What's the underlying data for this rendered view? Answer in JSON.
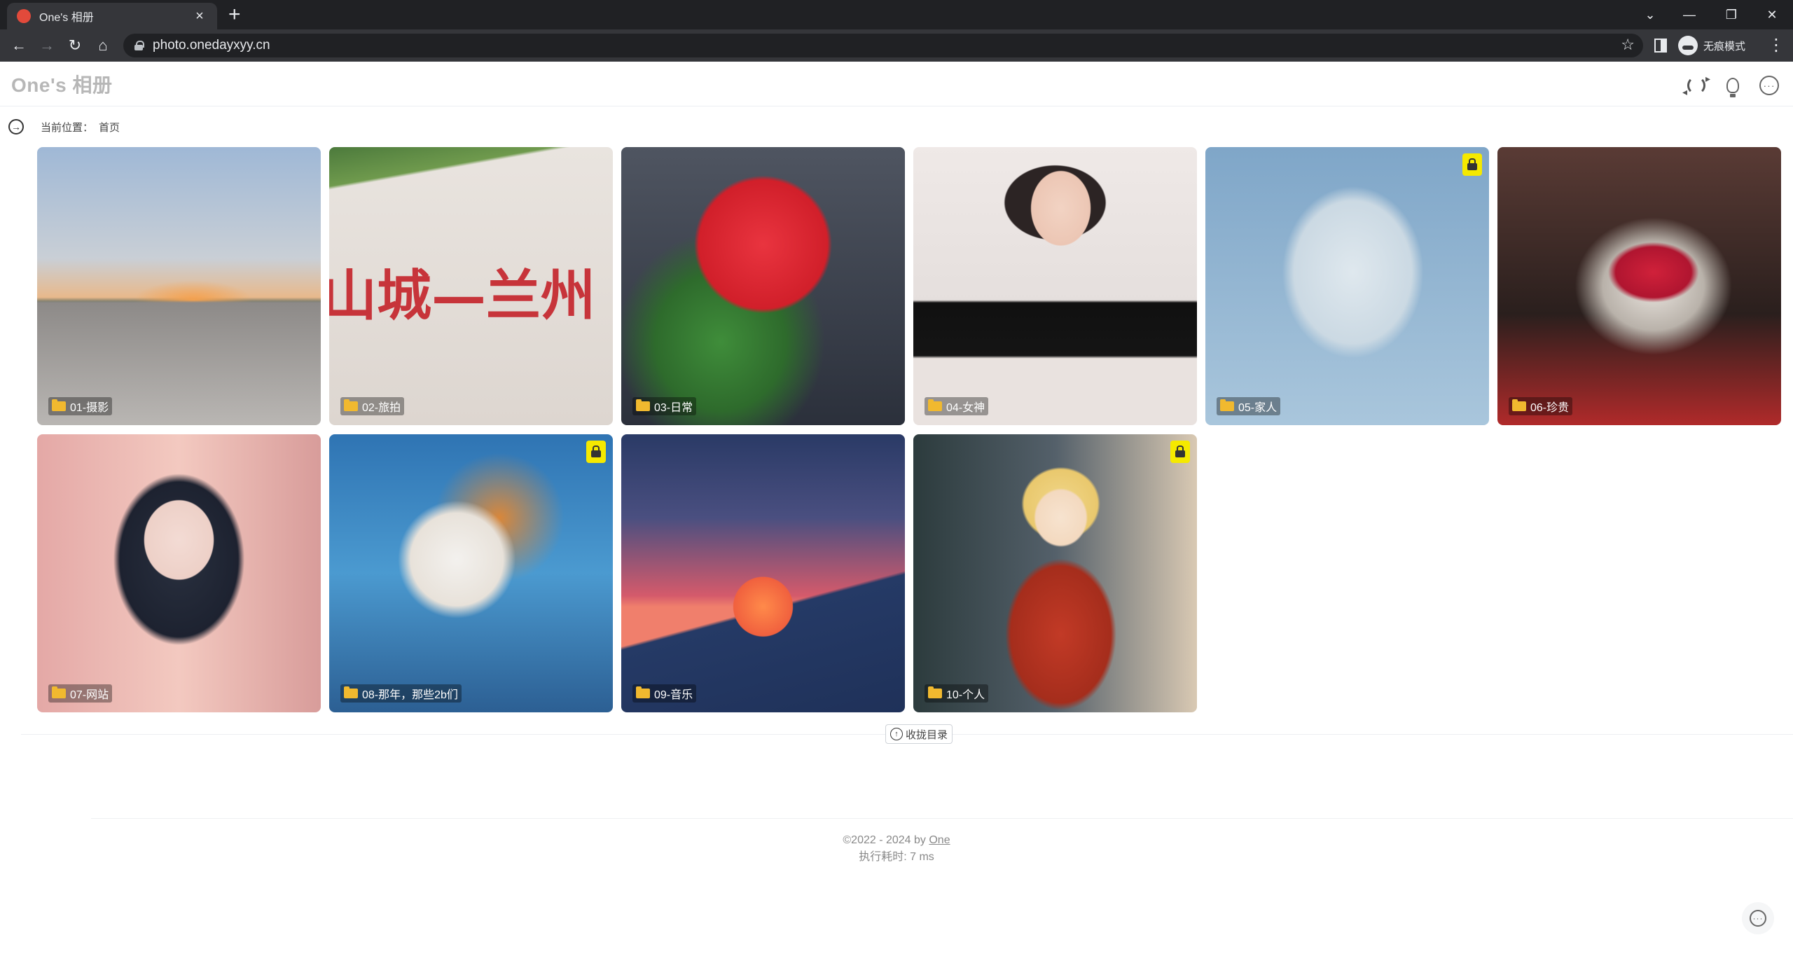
{
  "browser": {
    "tab_title": "One's 相册",
    "url": "photo.onedayxyy.cn",
    "profile_label": "无痕模式",
    "icons": {
      "back": "arrow-left-icon",
      "forward": "arrow-right-icon",
      "reload": "reload-icon",
      "home": "home-icon",
      "star": "star-icon"
    }
  },
  "site": {
    "logo": "One's 相册"
  },
  "breadcrumb": {
    "label": "当前位置：",
    "current": "首页"
  },
  "albums": [
    {
      "label": "01-摄影",
      "locked": false
    },
    {
      "label": "02-旅拍",
      "locked": false,
      "wall_text": "山城—兰州"
    },
    {
      "label": "03-日常",
      "locked": false
    },
    {
      "label": "04-女神",
      "locked": false
    },
    {
      "label": "05-家人",
      "locked": true
    },
    {
      "label": "06-珍贵",
      "locked": false
    },
    {
      "label": "07-网站",
      "locked": false
    },
    {
      "label": "08-那年，那些2b们",
      "locked": true
    },
    {
      "label": "09-音乐",
      "locked": false
    },
    {
      "label": "10-个人",
      "locked": true
    }
  ],
  "collapse": {
    "label": "收拢目录"
  },
  "footer": {
    "copyright": "©2022 - 2024 by ",
    "author": "One",
    "runtime": "执行耗时: 7 ms"
  },
  "colors": {
    "lock_badge": "#f5e900",
    "folder": "#f1b92f",
    "logo": "#b7b7b7"
  }
}
